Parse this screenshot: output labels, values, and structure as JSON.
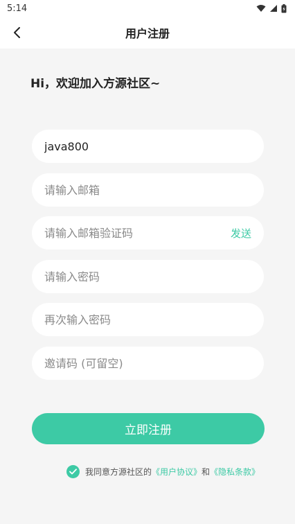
{
  "status_bar": {
    "time": "5:14"
  },
  "nav": {
    "title": "用户注册"
  },
  "greeting": "Hi，欢迎加入方源社区~",
  "form": {
    "username_value": "java800",
    "email_placeholder": "请输入邮箱",
    "code_placeholder": "请输入邮箱验证码",
    "send_label": "发送",
    "password_placeholder": "请输入密码",
    "confirm_placeholder": "再次输入密码",
    "invite_placeholder": "邀请码 (可留空)",
    "submit_label": "立即注册"
  },
  "agreement": {
    "checked": true,
    "prefix": "我同意方源社区的",
    "user_agreement": "《用户协议》",
    "and": "和",
    "privacy_policy": "《隐私条款》"
  },
  "colors": {
    "accent": "#3dcaa5",
    "background": "#f5f5f5"
  }
}
